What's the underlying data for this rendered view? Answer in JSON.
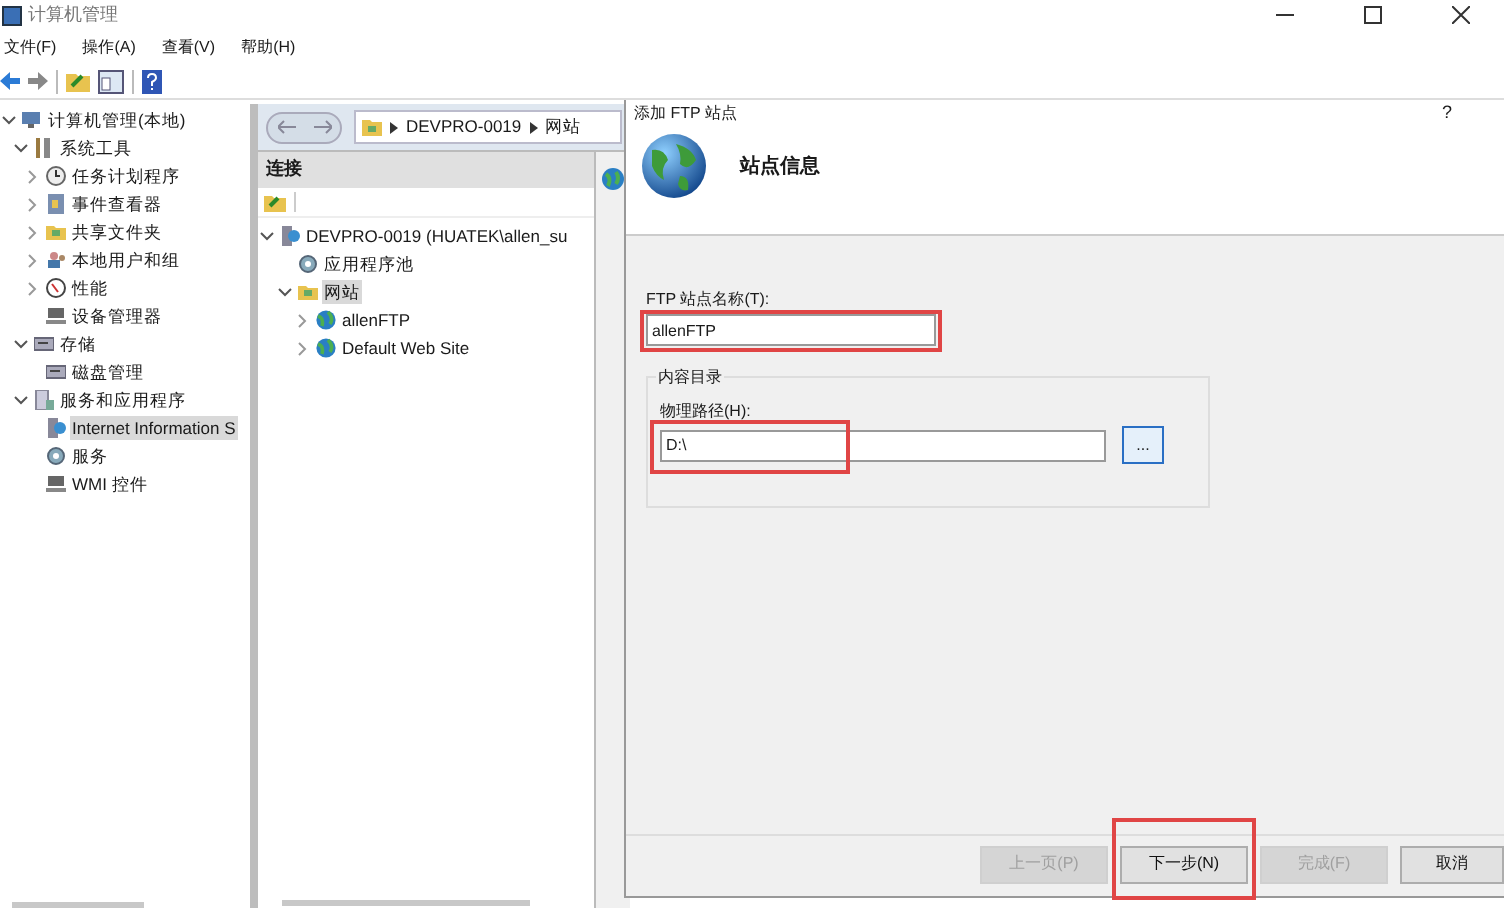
{
  "window": {
    "title": "计算机管理"
  },
  "menu": [
    "文件(F)",
    "操作(A)",
    "查看(V)",
    "帮助(H)"
  ],
  "tree": [
    {
      "label": "计算机管理(本地)",
      "kind": "computer",
      "expanded": true,
      "selected": false,
      "children": [
        {
          "label": "系统工具",
          "kind": "tools",
          "expanded": true,
          "selected": false,
          "children": [
            {
              "label": "任务计划程序",
              "kind": "clock",
              "expanded": false,
              "selected": false
            },
            {
              "label": "事件查看器",
              "kind": "log",
              "expanded": false,
              "selected": false
            },
            {
              "label": "共享文件夹",
              "kind": "folder",
              "expanded": false,
              "selected": false
            },
            {
              "label": "本地用户和组",
              "kind": "users",
              "expanded": false,
              "selected": false
            },
            {
              "label": "性能",
              "kind": "gauge",
              "expanded": false,
              "selected": false
            },
            {
              "label": "设备管理器",
              "kind": "device",
              "selected": false
            }
          ]
        },
        {
          "label": "存储",
          "kind": "disk",
          "expanded": true,
          "selected": false,
          "children": [
            {
              "label": "磁盘管理",
              "kind": "disk",
              "selected": false
            }
          ]
        },
        {
          "label": "服务和应用程序",
          "kind": "services",
          "expanded": true,
          "selected": false,
          "children": [
            {
              "label": "Internet Information S",
              "kind": "server",
              "selected": true
            },
            {
              "label": "服务",
              "kind": "gear",
              "selected": false
            },
            {
              "label": "WMI 控件",
              "kind": "device",
              "selected": false
            }
          ]
        }
      ]
    }
  ],
  "iis": {
    "breadcrumb": [
      "DEVPRO-0019",
      "网站"
    ],
    "connections_title": "连接",
    "tree": [
      {
        "label": "DEVPRO-0019 (HUATEK\\allen_su",
        "kind": "server",
        "expanded": true,
        "selected": false,
        "children": [
          {
            "label": "应用程序池",
            "kind": "gear",
            "selected": false
          },
          {
            "label": "网站",
            "kind": "folder",
            "expanded": true,
            "selected": true,
            "children": [
              {
                "label": "allenFTP",
                "kind": "globe",
                "expanded": false,
                "selected": false
              },
              {
                "label": "Default Web Site",
                "kind": "globe",
                "expanded": false,
                "selected": false
              }
            ]
          }
        ]
      }
    ]
  },
  "dialog": {
    "title": "添加 FTP 站点",
    "help": "?",
    "heading": "站点信息",
    "name_field": {
      "label": "FTP 站点名称(T):",
      "value": "allenFTP",
      "highlighted": true
    },
    "group": {
      "title": "内容目录",
      "path_field": {
        "label": "物理路径(H):",
        "value": "D:\\",
        "highlighted": true
      },
      "browse": "..."
    },
    "buttons": [
      {
        "label": "上一页(P)",
        "disabled": true,
        "highlighted": false
      },
      {
        "label": "下一步(N)",
        "disabled": false,
        "highlighted": true
      },
      {
        "label": "完成(F)",
        "disabled": true,
        "highlighted": false
      },
      {
        "label": "取消",
        "disabled": false,
        "highlighted": false
      }
    ]
  }
}
